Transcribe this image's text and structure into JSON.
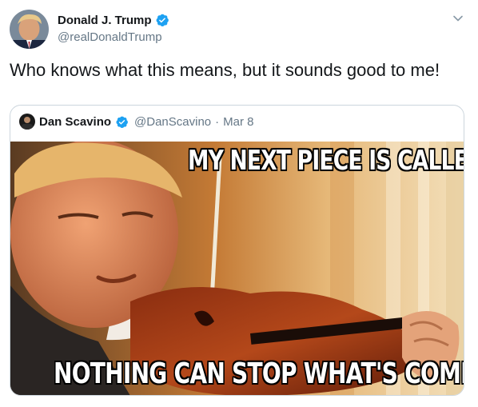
{
  "author": {
    "name": "Donald J. Trump",
    "handle": "@realDonaldTrump",
    "verified": true
  },
  "tweet": {
    "text": "Who knows what this means, but it sounds good to me!"
  },
  "quoted": {
    "name": "Dan Scavino",
    "handle": "@DanScavino",
    "separator": "·",
    "date": "Mar 8",
    "verified": true,
    "image": {
      "caption_top": "MY NEXT PIECE IS CALLED",
      "caption_bottom": "NOTHING CAN STOP WHAT'S COMING"
    }
  },
  "colors": {
    "verified_blue": "#1da1f2",
    "secondary_text": "#657786",
    "border": "#ccd6dd"
  },
  "icons": {
    "more": "chevron-down-icon",
    "verified": "verified-badge-icon"
  }
}
